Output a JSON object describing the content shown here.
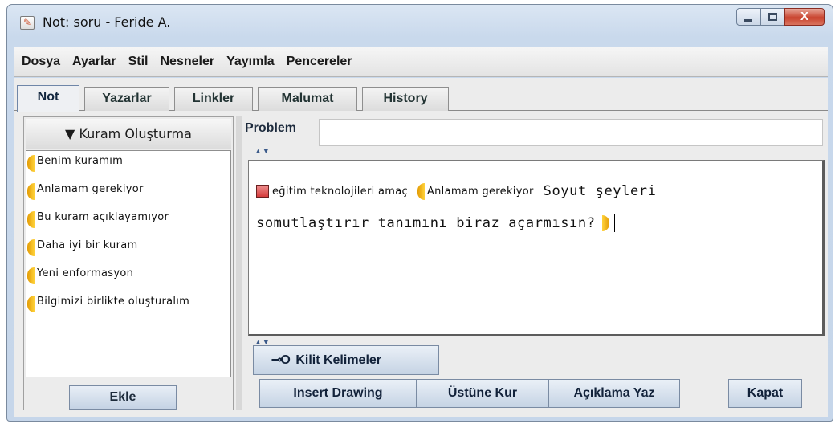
{
  "window": {
    "title": "Not: soru - Feride A.",
    "close_glyph": "X"
  },
  "menu": [
    "Dosya",
    "Ayarlar",
    "Stil",
    "Nesneler",
    "Yayımla",
    "Pencereler"
  ],
  "tabs": [
    "Not",
    "Yazarlar",
    "Linkler",
    "Malumat",
    "History"
  ],
  "active_tab": "Not",
  "sidebar": {
    "header": "▼ Kuram Oluşturma",
    "items": [
      "Benim kuramım",
      "Anlamam gerekiyor",
      "Bu kuram açıklayamıyor",
      "Daha iyi bir kuram",
      "Yeni enformasyon",
      "Bilgimizi birlikte oluşturalım"
    ],
    "add_button": "Ekle"
  },
  "problem": {
    "label": "Problem",
    "value": ""
  },
  "editor": {
    "link_label": "eğitim teknolojileri amaç",
    "scaffold_label": "Anlamam gerekiyor",
    "text_line1": "Soyut şeyleri",
    "text_line2": "somutlaştırır tanımını biraz açarmısın?"
  },
  "keywords_button": "Kilit Kelimeler",
  "actions": {
    "insert_drawing": "Insert Drawing",
    "build_on": "Üstüne Kur",
    "write_explanation": "Açıklama Yaz",
    "close": "Kapat"
  },
  "icons": {
    "app": "note-app-icon",
    "key": "key-icon",
    "scaffold": "scaffold-bracket-icon",
    "link": "note-link-icon"
  },
  "colors": {
    "scaffold_bracket": "#f2b210",
    "link_box": "#d53b3b",
    "close_button": "#c9442f"
  }
}
